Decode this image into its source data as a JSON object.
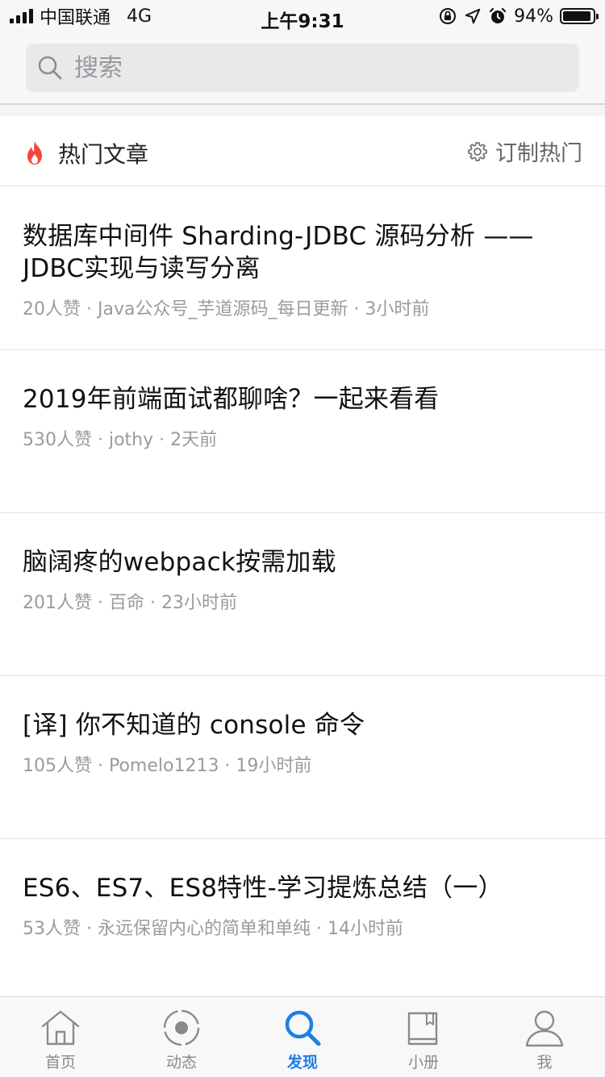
{
  "status_bar": {
    "carrier": "中国联通",
    "network": "4G",
    "time": "上午9:31",
    "battery": "94%",
    "battery_level": 0.94
  },
  "search": {
    "placeholder": "搜索"
  },
  "hot_section": {
    "title": "热门文章",
    "customize_label": "订制热门"
  },
  "articles": [
    {
      "title": "数据库中间件 Sharding-JDBC 源码分析 —— JDBC实现与读写分离",
      "meta": "20人赞 · Java公众号_芋道源码_每日更新 · 3小时前"
    },
    {
      "title": "2019年前端面试都聊啥？一起来看看",
      "meta": "530人赞 · jothy · 2天前"
    },
    {
      "title": "脑阔疼的webpack按需加载",
      "meta": "201人赞 · 百命 · 23小时前"
    },
    {
      "title": "[译] 你不知道的 console 命令",
      "meta": "105人赞 · Pomelo1213 · 19小时前"
    },
    {
      "title": "ES6、ES7、ES8特性-学习提炼总结（一）",
      "meta": "53人赞 · 永远保留内心的简单和单纯 · 14小时前"
    }
  ],
  "tabs": [
    {
      "label": "首页",
      "icon": "home-icon"
    },
    {
      "label": "动态",
      "icon": "activity-icon"
    },
    {
      "label": "发现",
      "icon": "search-icon",
      "active": true
    },
    {
      "label": "小册",
      "icon": "book-icon"
    },
    {
      "label": "我",
      "icon": "user-icon"
    }
  ],
  "colors": {
    "accent": "#1d7ee6",
    "flame": "#f5463c",
    "meta_text": "#9b9b9b"
  }
}
